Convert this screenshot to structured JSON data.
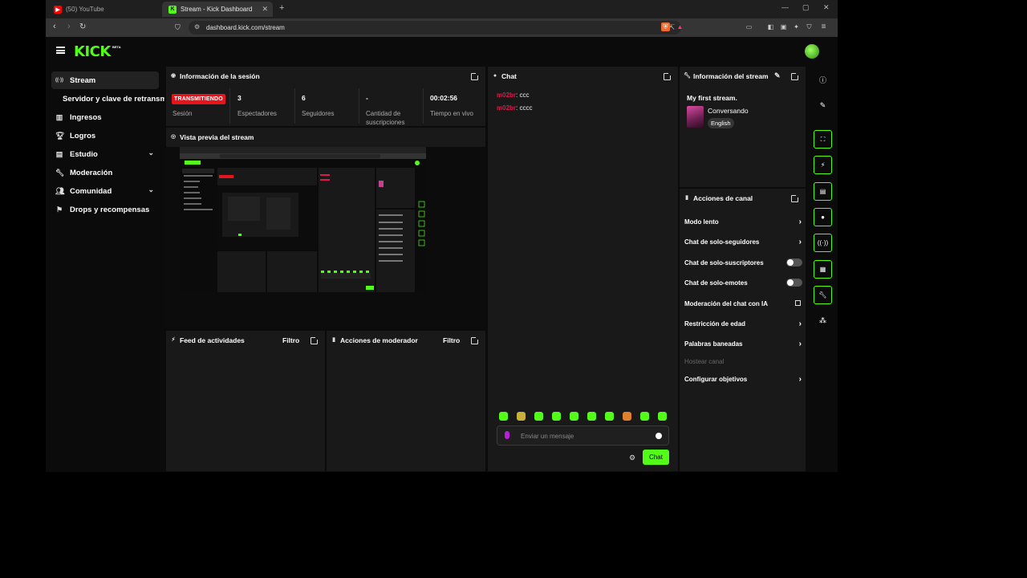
{
  "browser": {
    "tabs": [
      {
        "title": "(50) YouTube",
        "active": false,
        "favicon_color": "#ff0000"
      },
      {
        "title": "Stream - Kick Dashboard",
        "active": true,
        "favicon_color": "#53fc18"
      }
    ],
    "new_tab_icon": "+",
    "url": "dashboard.kick.com/stream"
  },
  "header": {
    "logo": "KICK",
    "logo_badge": "BETA"
  },
  "sidebar": {
    "items": [
      {
        "label": "Stream",
        "icon": "broadcast-icon",
        "glyph": "((·))",
        "active": true
      },
      {
        "label": "Servidor y clave de retransmisión",
        "icon": "",
        "glyph": "",
        "active": false
      },
      {
        "label": "Ingresos",
        "icon": "chart-icon",
        "glyph": "▥",
        "active": false
      },
      {
        "label": "Logros",
        "icon": "trophy-icon",
        "glyph": "🏆︎",
        "active": false
      },
      {
        "label": "Estudio",
        "icon": "studio-icon",
        "glyph": "▤",
        "active": false,
        "expandable": true
      },
      {
        "label": "Moderación",
        "icon": "wrench-icon",
        "glyph": "🔧︎",
        "active": false
      },
      {
        "label": "Comunidad",
        "icon": "community-icon",
        "glyph": "👥︎",
        "active": false,
        "expandable": true
      },
      {
        "label": "Drops y recompensas",
        "icon": "gift-icon",
        "glyph": "⚑",
        "active": false
      }
    ]
  },
  "session": {
    "title": "Información de la sesión",
    "live_badge": "TRANSMITIENDO",
    "stats": [
      {
        "label": "Sesión",
        "value": ""
      },
      {
        "label": "Espectadores",
        "value": "3"
      },
      {
        "label": "Seguidores",
        "value": "6"
      },
      {
        "label": "Cantidad de suscripciones",
        "value": "-"
      },
      {
        "label": "Tiempo en vivo",
        "value": "00:02:56"
      }
    ]
  },
  "preview": {
    "title": "Vista previa del stream"
  },
  "activity_feed": {
    "title": "Feed de actividades",
    "filter_label": "Filtro"
  },
  "mod_actions": {
    "title": "Acciones de moderador",
    "filter_label": "Filtro"
  },
  "chat": {
    "title": "Chat",
    "messages": [
      {
        "user": "m02br",
        "text": ": ccc"
      },
      {
        "user": "m02br",
        "text": ": cccc"
      }
    ],
    "input_placeholder": "Enviar un mensaje",
    "send_label": "Chat",
    "emote_count": 10
  },
  "stream_info": {
    "title": "Información del stream",
    "stream_title": "My first stream.",
    "category": "Conversando",
    "language_tag": "English"
  },
  "channel_actions": {
    "title": "Acciones de canal",
    "items": [
      {
        "label": "Modo lento",
        "control": "chevron"
      },
      {
        "label": "Chat de solo-seguidores",
        "control": "chevron"
      },
      {
        "label": "Chat de solo-suscriptores",
        "control": "toggle",
        "enabled": false
      },
      {
        "label": "Chat de solo-emotes",
        "control": "toggle",
        "enabled": false
      },
      {
        "label": "Moderación del chat con IA",
        "control": "external"
      },
      {
        "label": "Restricción de edad",
        "control": "chevron"
      },
      {
        "label": "Palabras baneadas",
        "control": "chevron"
      },
      {
        "label": "Hostear canal",
        "control": "none",
        "disabled": true
      },
      {
        "label": "Configurar objetivos",
        "control": "chevron"
      }
    ]
  },
  "colors": {
    "brand": "#53fc18",
    "live": "#e5151d",
    "username": "#e0174b",
    "panel": "#191919",
    "background": "#0b0b0b"
  }
}
